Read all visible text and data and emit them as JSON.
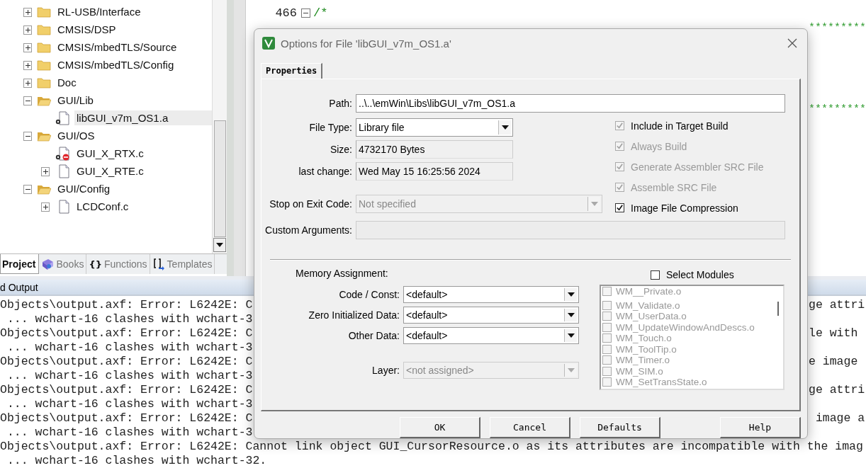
{
  "project_tree": [
    {
      "label": "RL-USB/Interface",
      "kind": "folder",
      "expanded": false,
      "selected": false
    },
    {
      "label": "CMSIS/DSP",
      "kind": "folder",
      "expanded": false,
      "selected": false
    },
    {
      "label": "CMSIS/mbedTLS/Source",
      "kind": "folder",
      "expanded": false,
      "selected": false
    },
    {
      "label": "CMSIS/mbedTLS/Config",
      "kind": "folder",
      "expanded": false,
      "selected": false
    },
    {
      "label": "Doc",
      "kind": "folder",
      "expanded": false,
      "selected": false
    },
    {
      "label": "GUI/Lib",
      "kind": "folder",
      "expanded": true,
      "selected": false,
      "children": [
        {
          "label": "libGUI_v7m_OS1.a",
          "kind": "library",
          "selected": true
        }
      ]
    },
    {
      "label": "GUI/OS",
      "kind": "folder",
      "expanded": true,
      "selected": false,
      "children": [
        {
          "label": "GUI_X_RTX.c",
          "kind": "excluded-file",
          "selected": false
        },
        {
          "label": "GUI_X_RTE.c",
          "kind": "file",
          "expanded": false,
          "selected": false
        }
      ]
    },
    {
      "label": "GUI/Config",
      "kind": "folder",
      "expanded": true,
      "selected": false,
      "children": [
        {
          "label": "LCDConf.c",
          "kind": "file",
          "expanded": false,
          "selected": false
        }
      ]
    }
  ],
  "panel_tabs": [
    {
      "label": "Project",
      "kind": "plain",
      "selected": true
    },
    {
      "label": "Books",
      "kind": "book",
      "selected": false
    },
    {
      "label": "Functions",
      "kind": "braces",
      "glyph": "{}",
      "selected": false
    },
    {
      "label": "Templates",
      "kind": "template",
      "selected": false
    }
  ],
  "editor": {
    "lines": [
      {
        "number": "466",
        "text": "/*",
        "fold": true
      }
    ],
    "right_fragments": [
      "*********",
      "*********"
    ]
  },
  "output": {
    "title": "d Output",
    "lines": [
      {
        "left": "Objects\\output.axf: Error: L6242E: C",
        "right": "ge attri"
      },
      {
        "left": " ... wchart-16 clashes with wchart-3"
      },
      {
        "left": "Objects\\output.axf: Error: L6242E: C",
        "right": "le with"
      },
      {
        "left": " ... wchart-16 clashes with wchart-3"
      },
      {
        "left": "Objects\\output.axf: Error: L6242E: C",
        "right": "e image"
      },
      {
        "left": " ... wchart-16 clashes with wchart-3"
      },
      {
        "left": "Objects\\output.axf: Error: L6242E: C",
        "right": "ge attri"
      },
      {
        "left": " ... wchart-16 clashes with wchart-3"
      },
      {
        "left": "Objects\\output.axf: Error: L6242E: C",
        "right": " image a"
      },
      {
        "left": " ... wchart-16 clashes with wchart-3"
      },
      {
        "full": "Objects\\output.axf: Error: L6242E: Cannot link object GUI_CursorResource.o as its attributes are incompatible with the imag"
      },
      {
        "full": " ... wchart-16 clashes with wchart-32."
      }
    ]
  },
  "dialog": {
    "title": "Options for File 'libGUI_v7m_OS1.a'",
    "tabs": [
      {
        "label": "Properties",
        "selected": true
      }
    ],
    "fields": [
      {
        "label": "Path:",
        "kind": "text",
        "value": "..\\..\\emWin\\Libs\\libGUI_v7m_OS1.a",
        "disabled": false
      },
      {
        "label": "File Type:",
        "kind": "select",
        "value": "Library file",
        "disabled": false
      },
      {
        "label": "Size:",
        "kind": "readonly",
        "value": "4732170 Bytes",
        "disabled": false
      },
      {
        "label": "last change:",
        "kind": "readonly",
        "value": "Wed May 15 16:25:56 2024",
        "disabled": false
      },
      {
        "label": "Stop on Exit Code:",
        "kind": "select",
        "value": "Not specified",
        "disabled": true
      },
      {
        "label": "Custom Arguments:",
        "kind": "text",
        "disabled": true
      }
    ],
    "options": [
      {
        "label": "Include in Target Build",
        "checked": true,
        "disabled": false,
        "box_disabled": true
      },
      {
        "label": "Always Build",
        "checked": true,
        "disabled": true,
        "box_disabled": true
      },
      {
        "label": "Generate Assembler SRC File",
        "checked": true,
        "disabled": true,
        "box_disabled": true
      },
      {
        "label": "Assemble SRC File",
        "checked": true,
        "disabled": true,
        "box_disabled": true
      },
      {
        "label": "Image File Compression",
        "checked": true,
        "disabled": false,
        "box_disabled": false
      }
    ],
    "memory_title": "Memory Assignment:",
    "memory": [
      {
        "label": "Code / Const:",
        "value": "<default>",
        "disabled": false
      },
      {
        "label": "Zero Initialized Data:",
        "value": "<default>",
        "disabled": false
      },
      {
        "label": "Other Data:",
        "value": "<default>",
        "disabled": false
      },
      {
        "label": "Layer:",
        "value": "<not assigned>",
        "disabled": true
      }
    ],
    "select_modules": {
      "label": "Select Modules",
      "checked": false
    },
    "modules": [
      {
        "label": "WM__Private.o",
        "checked": false
      },
      {
        "label": "WM_Validate.o",
        "checked": false
      },
      {
        "label": "WM_UserData.o",
        "checked": false
      },
      {
        "label": "WM_UpdateWindowAndDescs.o",
        "checked": false
      },
      {
        "label": "WM_Touch.o",
        "checked": false
      },
      {
        "label": "WM_ToolTip.o",
        "checked": false
      },
      {
        "label": "WM_Timer.o",
        "checked": false
      },
      {
        "label": "WM_SIM.o",
        "checked": false
      },
      {
        "label": "WM_SetTransState.o",
        "checked": false
      }
    ],
    "buttons": [
      "OK",
      "Cancel",
      "Defaults",
      "Help"
    ]
  }
}
